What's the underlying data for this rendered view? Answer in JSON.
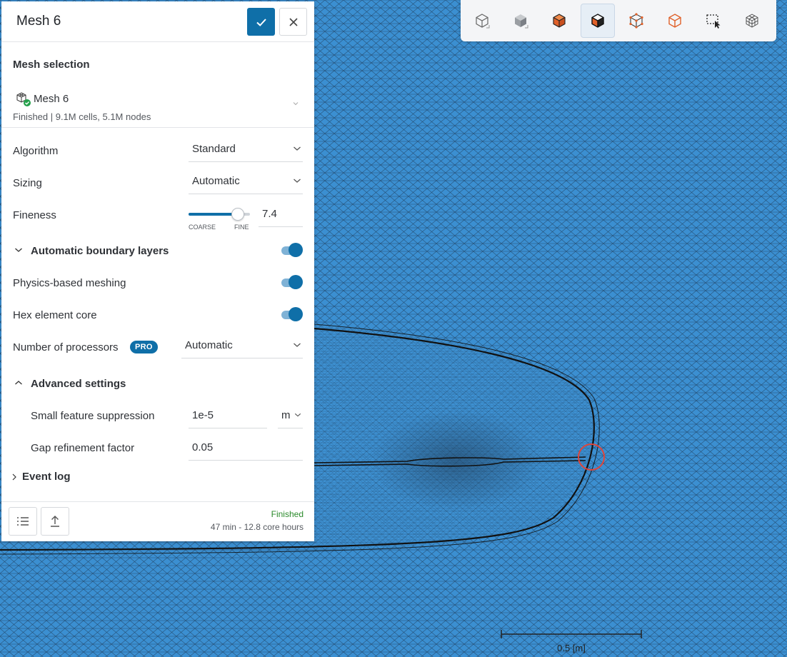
{
  "panel": {
    "title": "Mesh 6",
    "mesh_selection": {
      "heading": "Mesh selection",
      "name": "Mesh 6",
      "status": "Finished | 9.1M cells, 5.1M nodes"
    },
    "algorithm": {
      "label": "Algorithm",
      "value": "Standard"
    },
    "sizing": {
      "label": "Sizing",
      "value": "Automatic"
    },
    "fineness": {
      "label": "Fineness",
      "value": "7.4",
      "min_label": "COARSE",
      "max_label": "FINE",
      "level": 0.8
    },
    "boundary_layers": {
      "label": "Automatic boundary layers",
      "enabled": true
    },
    "physics_meshing": {
      "label": "Physics-based meshing",
      "enabled": true
    },
    "hex_core": {
      "label": "Hex element core",
      "enabled": true
    },
    "processors": {
      "label": "Number of processors",
      "badge": "PRO",
      "value": "Automatic"
    },
    "advanced": {
      "label": "Advanced settings",
      "small_feature": {
        "label": "Small feature suppression",
        "value": "1e-5",
        "unit": "m"
      },
      "gap_factor": {
        "label": "Gap refinement factor",
        "value": "0.05"
      }
    },
    "event_log": {
      "label": "Event log"
    },
    "footer": {
      "status": "Finished",
      "duration": "47 min - 12.8 core hours"
    }
  },
  "viewport": {
    "scale_label": "0.5 [m]",
    "mesh_color": "#3b8fd1",
    "accent": "#0f6fa8",
    "highlight": "#e0453a"
  },
  "toolbar": {
    "icons": [
      "cube-outline-icon",
      "cube-solid-icon",
      "cube-orange-faces-icon",
      "cube-black-orange-icon",
      "cube-vertices-icon",
      "cube-edges-icon",
      "box-select-icon",
      "mesh-cube-icon"
    ]
  }
}
